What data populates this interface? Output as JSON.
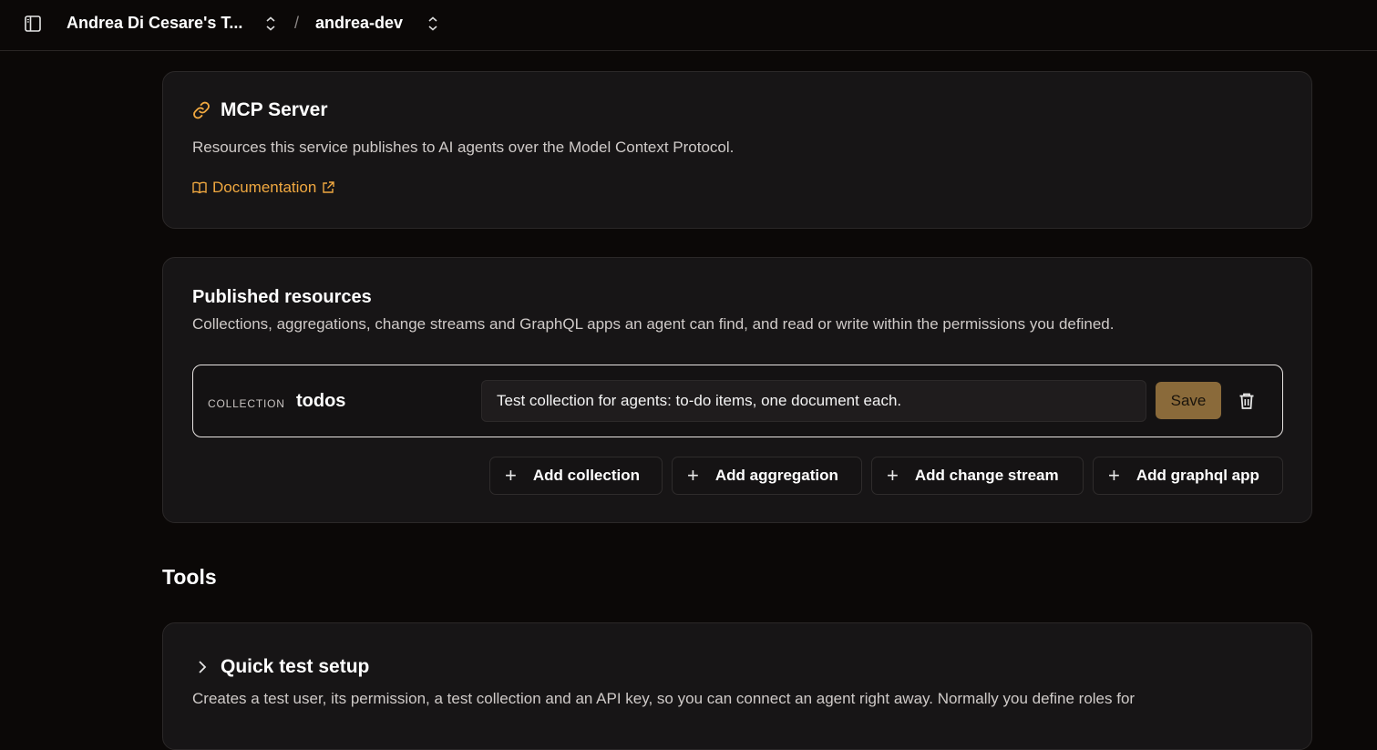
{
  "header": {
    "team_name": "Andrea Di Cesare's T...",
    "separator": "/",
    "project_name": "andrea-dev"
  },
  "mcp": {
    "title": "MCP Server",
    "description": "Resources this service publishes to AI agents over the Model Context Protocol.",
    "doc_link": "Documentation",
    "accent_color": "#f0a840"
  },
  "resources": {
    "title": "Published resources",
    "description": "Collections, aggregations, change streams and GraphQL apps an agent can find, and read or write within the permissions you defined.",
    "items": [
      {
        "kind": "COLLECTION",
        "name": "todos",
        "description_value": "Test collection for agents: to-do items, one document each.",
        "save_label": "Save"
      }
    ],
    "add_buttons": [
      "Add collection",
      "Add aggregation",
      "Add change stream",
      "Add graphql app"
    ]
  },
  "tools": {
    "heading": "Tools",
    "quick_setup_title": "Quick test setup",
    "quick_setup_description": "Creates a test user, its permission, a test collection and an API key, so you can connect an agent right away. Normally you define roles for"
  }
}
